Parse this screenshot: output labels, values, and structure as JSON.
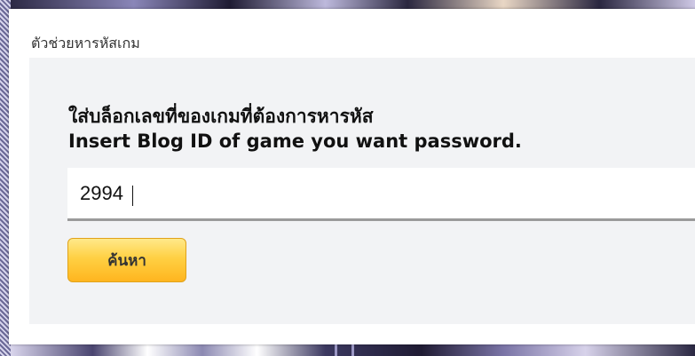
{
  "panel": {
    "title": "ตัวช่วยหารหัสเกม"
  },
  "form": {
    "heading_th": "ใส่บล็อกเลขที่ของเกมที่ต้องการหารหัส",
    "heading_en": "Insert Blog ID of game you want password.",
    "input": {
      "value": "2994",
      "placeholder": ""
    },
    "search_button_label": "ค้นหา"
  },
  "colors": {
    "panel_bg": "#ffffff",
    "form_bg": "#f2f3f5",
    "button_top": "#ffe98a",
    "button_bottom": "#ffb51f",
    "input_border": "#9a9a9a"
  }
}
